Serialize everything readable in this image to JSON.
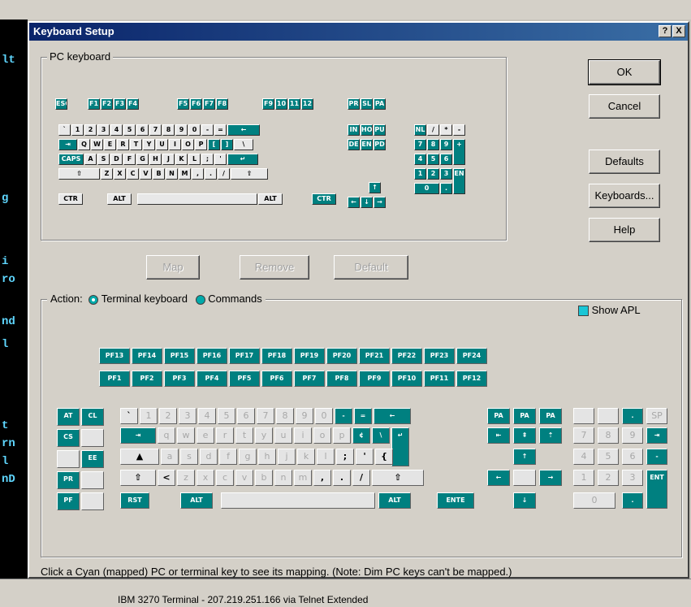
{
  "dialog": {
    "title": "Keyboard Setup",
    "help_btn": "?",
    "close_btn": "X"
  },
  "pc_group": {
    "label": "PC keyboard"
  },
  "buttons": {
    "ok": "OK",
    "cancel": "Cancel",
    "defaults": "Defaults",
    "keyboards": "Keyboards...",
    "help": "Help",
    "map": "Map",
    "remove": "Remove",
    "default": "Default"
  },
  "action": {
    "label": "Action:",
    "terminal": "Terminal keyboard",
    "commands": "Commands",
    "show_apl": "Show APL"
  },
  "hint": "Click a Cyan (mapped) PC or terminal key to see its mapping. (Note: Dim PC keys can't be mapped.)",
  "status": "IBM 3270 Terminal - 207.219.251.166 via Telnet Extended",
  "term_text": [
    "lt",
    "g",
    "i",
    "ro",
    "nd",
    "l",
    "t",
    "rn",
    "l",
    "nD"
  ],
  "pc_keys": {
    "fn_row": [
      "ESC",
      "F1",
      "F2",
      "F3",
      "F4",
      "F5",
      "F6",
      "F7",
      "F8",
      "F9",
      "10",
      "11",
      "12",
      "PR",
      "SL",
      "PA"
    ],
    "row1": [
      "`",
      "1",
      "2",
      "3",
      "4",
      "5",
      "6",
      "7",
      "8",
      "9",
      "0",
      "-",
      "=",
      "←"
    ],
    "row2": [
      "⇥",
      "Q",
      "W",
      "E",
      "R",
      "T",
      "Y",
      "U",
      "I",
      "O",
      "P",
      "[",
      "]",
      "\\"
    ],
    "row3": [
      "CAPS",
      "A",
      "S",
      "D",
      "F",
      "G",
      "H",
      "J",
      "K",
      "L",
      ";",
      "'",
      "↵"
    ],
    "row4": [
      "⇧",
      "Z",
      "X",
      "C",
      "V",
      "B",
      "N",
      "M",
      ",",
      ".",
      "/",
      "⇧"
    ],
    "row5": [
      "CTR",
      "ALT",
      "",
      "ALT",
      "CTR"
    ],
    "nav": [
      "IN",
      "HO",
      "PU",
      "DE",
      "EN",
      "PD"
    ],
    "arrows": [
      "↑",
      "←",
      "↓",
      "→"
    ],
    "numpad": [
      "NL",
      "/",
      "*",
      "-",
      "7",
      "8",
      "9",
      "+",
      "4",
      "5",
      "6",
      "1",
      "2",
      "3",
      "EN",
      "0",
      "."
    ]
  },
  "term_keys": {
    "pf_top": [
      "PF13",
      "PF14",
      "PF15",
      "PF16",
      "PF17",
      "PF18",
      "PF19",
      "PF20",
      "PF21",
      "PF22",
      "PF23",
      "PF24"
    ],
    "pf_bottom": [
      "PF1",
      "PF2",
      "PF3",
      "PF4",
      "PF5",
      "PF6",
      "PF7",
      "PF8",
      "PF9",
      "PF10",
      "PF11",
      "PF12"
    ],
    "left_block": [
      "AT",
      "CL",
      "CS",
      "",
      "",
      "EE",
      "PR",
      "",
      "PF",
      ""
    ],
    "row1": [
      "`",
      "1",
      "2",
      "3",
      "4",
      "5",
      "6",
      "7",
      "8",
      "9",
      "0",
      "-",
      "=",
      "←"
    ],
    "row2": [
      "⇥",
      "q",
      "w",
      "e",
      "r",
      "t",
      "y",
      "u",
      "i",
      "o",
      "p",
      "¢",
      "\\",
      "↵"
    ],
    "row3": [
      "▲",
      "a",
      "s",
      "d",
      "f",
      "g",
      "h",
      "j",
      "k",
      "l",
      ";",
      "'",
      "{"
    ],
    "row4": [
      "⇧",
      "<",
      "z",
      "x",
      "c",
      "v",
      "b",
      "n",
      "m",
      ",",
      ".",
      "/",
      "⇧"
    ],
    "row5": [
      "RST",
      "ALT",
      "",
      "ALT",
      "ENTE"
    ],
    "cursor": [
      "PA",
      "PA",
      "PA",
      "⇤",
      "⇞",
      "⇡",
      "↑",
      "←",
      "",
      "→",
      "↓"
    ],
    "numpad": [
      "",
      "",
      ".",
      "SP",
      "7",
      "8",
      "9",
      "⇥",
      "4",
      "5",
      "6",
      "-",
      "1",
      "2",
      "3",
      "ENT",
      "0",
      "."
    ]
  }
}
